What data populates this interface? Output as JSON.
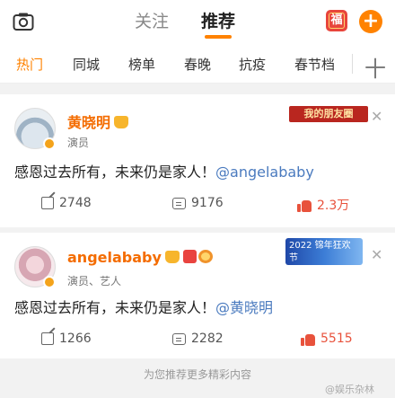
{
  "header": {
    "tabs": [
      "关注",
      "推荐"
    ],
    "fu_label": "福",
    "plus_label": "+"
  },
  "channels": [
    "热门",
    "同城",
    "榜单",
    "春晚",
    "抗疫",
    "春节档"
  ],
  "channel_plus": "十",
  "posts": [
    {
      "username": "黄晓明",
      "role": "演员",
      "banner": "我的朋友圈",
      "text": "感恩过去所有，未来仍是家人！",
      "mention": "@angelababy",
      "reposts": "2748",
      "comments": "9176",
      "likes": "2.3万"
    },
    {
      "username": "angelababy",
      "role": "演员、艺人",
      "banner": "2022 锦年狂欢节",
      "text": "感恩过去所有，未来仍是家人！",
      "mention": "@黄晓明",
      "reposts": "1266",
      "comments": "2282",
      "likes": "5515"
    }
  ],
  "footer": {
    "more": "为您推荐更多精彩内容",
    "watermark": "@娱乐杂林"
  },
  "colors": {
    "accent": "#ff8200",
    "username": "#f46c00",
    "mention": "#4b7bbf",
    "like": "#e8523c"
  }
}
